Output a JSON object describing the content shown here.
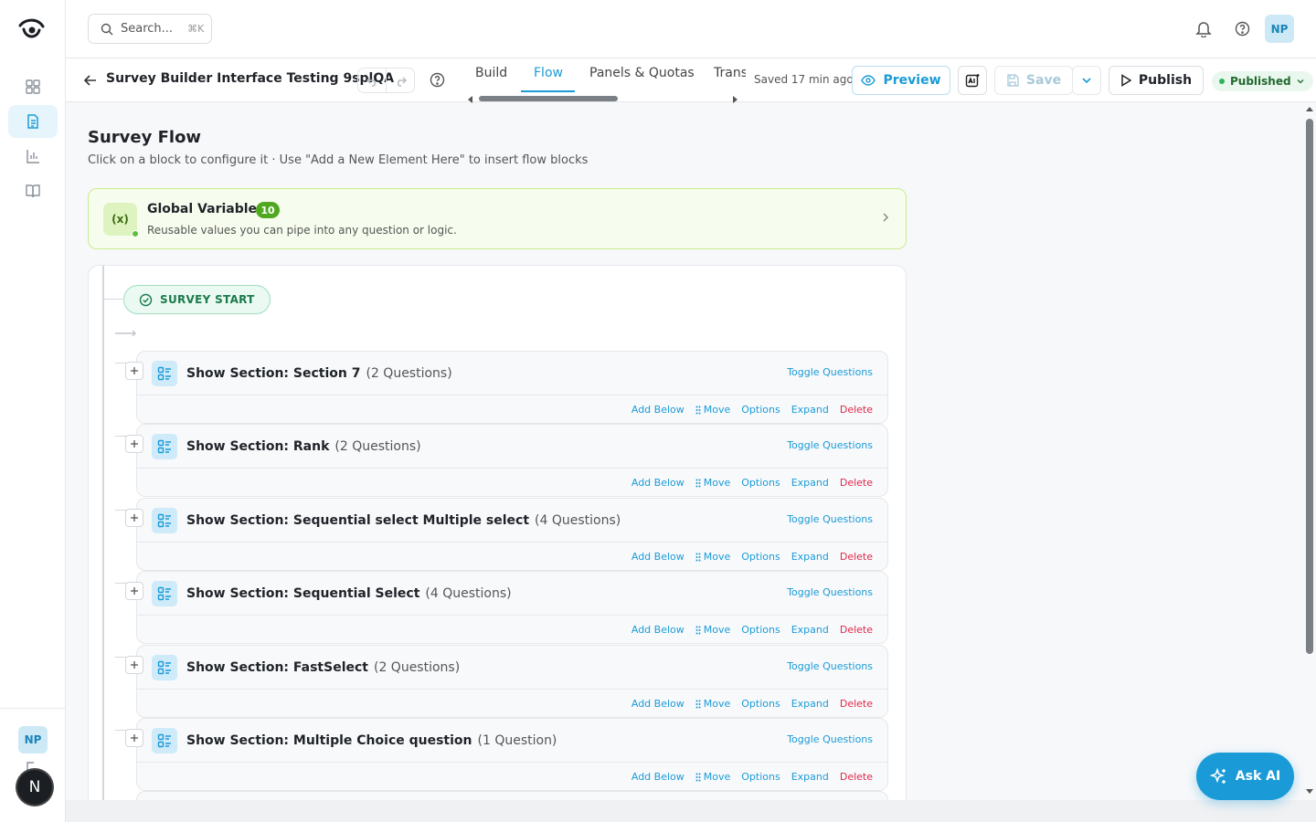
{
  "search": {
    "placeholder": "Search...",
    "shortcut": "⌘K"
  },
  "user": {
    "initials": "NP",
    "bottom_badge": "N"
  },
  "header": {
    "title": "Survey Builder Interface Testing 9splQA",
    "tabs": [
      "Build",
      "Flow",
      "Panels & Quotas",
      "Trans"
    ],
    "active_tab": "Flow",
    "saved_text": "Saved 17 min ago",
    "preview_label": "Preview",
    "save_label": "Save",
    "publish_label": "Publish",
    "status_label": "Published"
  },
  "page": {
    "title": "Survey Flow",
    "subtitle": "Click on a block to configure it · Use \"Add a New Element Here\" to insert flow blocks"
  },
  "global_variables": {
    "icon_text": "(x)",
    "name": "Global Variables",
    "count": "10",
    "description": "Reusable values you can pipe into any question or logic."
  },
  "flow": {
    "start_label": "SURVEY START",
    "toggle_label": "Toggle Questions",
    "actions": {
      "add_below": "Add Below",
      "move": "Move",
      "options": "Options",
      "expand": "Expand",
      "delete": "Delete"
    },
    "blocks": [
      {
        "title": "Show Section: Section 7",
        "count": "(2 Questions)"
      },
      {
        "title": "Show Section: Rank",
        "count": "(2 Questions)"
      },
      {
        "title": "Show Section: Sequential select Multiple select",
        "count": "(4 Questions)"
      },
      {
        "title": "Show Section: Sequential Select",
        "count": "(4 Questions)"
      },
      {
        "title": "Show Section: FastSelect",
        "count": "(2 Questions)"
      },
      {
        "title": "Show Section: Multiple Choice question",
        "count": "(1 Question)"
      }
    ]
  },
  "ask_ai": {
    "label": "Ask AI"
  },
  "colors": {
    "accent": "#1a9bd7",
    "danger": "#e0284a",
    "success": "#2db35a",
    "gv_green": "#4fa81f"
  },
  "icons": [
    "logo-icon",
    "dashboard-icon",
    "document-icon",
    "chart-icon",
    "book-icon",
    "search-icon",
    "bell-icon",
    "help-icon",
    "back-arrow-icon",
    "undo-icon",
    "redo-icon",
    "eye-icon",
    "ai-image-icon",
    "save-icon",
    "chevron-down-icon",
    "play-icon",
    "chevron-right-icon",
    "check-circle-icon",
    "section-icon",
    "plus-icon",
    "drag-handle-icon",
    "sparkle-icon",
    "logout-icon"
  ]
}
